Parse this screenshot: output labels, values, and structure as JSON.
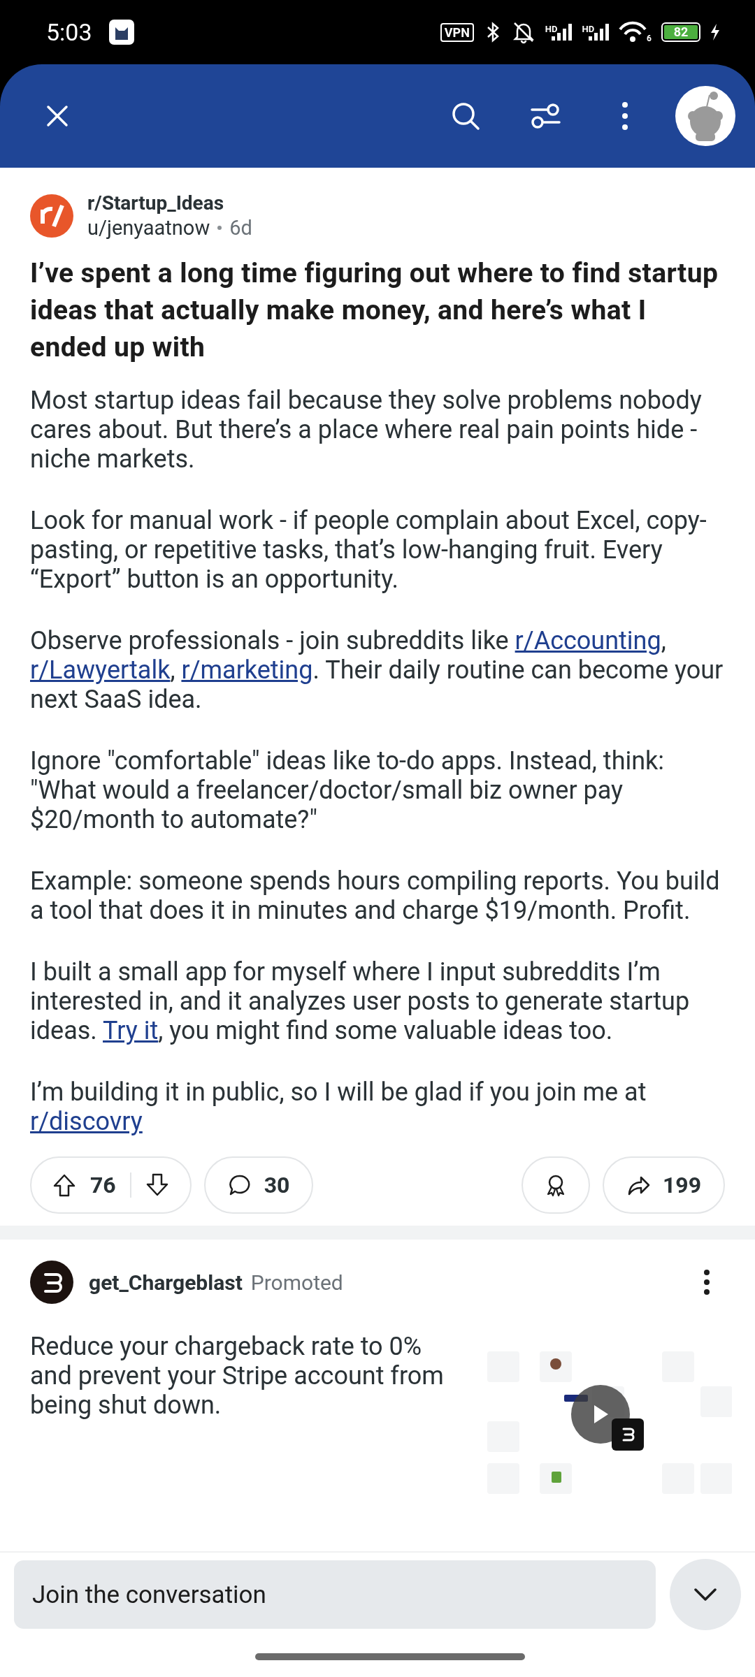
{
  "status_bar": {
    "time": "5:03",
    "vpn": "VPN",
    "signal_labels": [
      "HD",
      "HD"
    ],
    "wifi_label": "6",
    "battery": "82"
  },
  "header": {
    "buttons": [
      {
        "kind": "close"
      },
      {
        "kind": "search"
      },
      {
        "kind": "filter"
      },
      {
        "kind": "more"
      },
      {
        "kind": "avatar"
      }
    ]
  },
  "post": {
    "subreddit": "r/Startup_Ideas",
    "author": "u/jenyaatnow",
    "age": "6d",
    "title": "I’ve spent a long time figuring out where to find startup ideas that actually make money, and here’s what I ended up with",
    "paragraphs": [
      [
        {
          "kind": "text",
          "text": "Most startup ideas fail because they solve problems nobody cares about. But there’s a place where real pain points hide - niche markets."
        }
      ],
      [
        {
          "kind": "text",
          "text": "Look for manual work - if people complain about Excel, copy-pasting, or repetitive tasks, that’s low-hanging fruit. Every “Export” button is an opportunity."
        }
      ],
      [
        {
          "kind": "text",
          "text": "Observe professionals - join subreddits like "
        },
        {
          "kind": "link",
          "text": "r/Accounting"
        },
        {
          "kind": "text",
          "text": ", "
        },
        {
          "kind": "link",
          "text": "r/Lawyertalk"
        },
        {
          "kind": "text",
          "text": ", "
        },
        {
          "kind": "link",
          "text": "r/marketing"
        },
        {
          "kind": "text",
          "text": ". Their daily routine can become your next SaaS idea."
        }
      ],
      [
        {
          "kind": "text",
          "text": "Ignore \"comfortable\" ideas like to-do apps. Instead, think: \"What would a freelancer/doctor/small biz owner pay $20/month to automate?\""
        }
      ],
      [
        {
          "kind": "text",
          "text": "Example: someone spends hours compiling reports. You build a tool that does it in minutes and charge $19/month. Profit."
        }
      ],
      [
        {
          "kind": "text",
          "text": "I built a small app for myself where I input subreddits I’m interested in, and it analyzes user posts to generate startup ideas. "
        },
        {
          "kind": "link",
          "text": "Try it"
        },
        {
          "kind": "text",
          "text": ", you might find some valuable ideas too."
        }
      ],
      [
        {
          "kind": "text",
          "text": "I’m building it in public, so I will be glad if you join me at "
        },
        {
          "kind": "link",
          "text": "r/discovry"
        }
      ]
    ],
    "actions": {
      "upvotes": "76",
      "comments": "30",
      "shares": "199"
    }
  },
  "ad": {
    "advertiser": "get_Chargeblast",
    "label": "Promoted",
    "text": "Reduce your chargeback rate to 0% and prevent your Stripe account from being shut down."
  },
  "composer": {
    "placeholder": "Join the conversation"
  }
}
